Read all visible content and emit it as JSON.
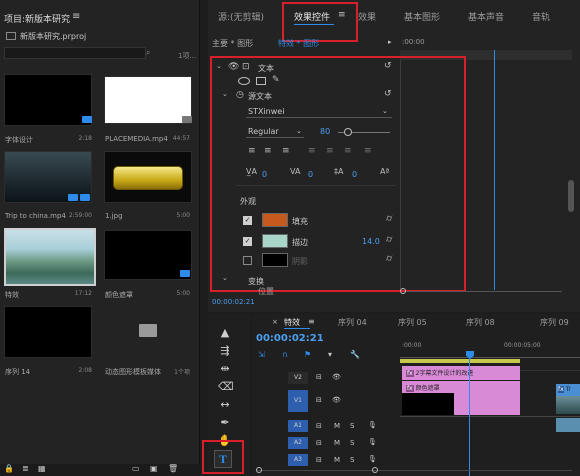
{
  "project": {
    "title": "项目:新版本研究",
    "menu_icon": "hamburger-icon",
    "file": "新版本研究.prproj",
    "count": "1项...",
    "items": [
      {
        "label": "字体设计",
        "dur": "2:18"
      },
      {
        "label": "PLACEMEDIA.mp4",
        "dur": "44:57"
      },
      {
        "label": "Trip to china.mp4",
        "dur": "2:59:00"
      },
      {
        "label": "1.jpg",
        "dur": "5:00"
      },
      {
        "label": "特效",
        "dur": "17:12"
      },
      {
        "label": "颜色遮罩",
        "dur": "5:00"
      },
      {
        "label": "序列 14",
        "dur": "2:08"
      },
      {
        "label": "动态图形模板媒体",
        "dur": "1个项"
      }
    ]
  },
  "effects": {
    "tabs": [
      "源:(无剪辑)",
      "效果控件",
      "效果",
      "基本图形",
      "基本声音",
      "音轨"
    ],
    "subhdr": "主要 * 图形",
    "subhdr2": "特效 * 图形",
    "ruler_time": ":00:00",
    "text_section": "文本",
    "source_text": "源文本",
    "font": "STXinwei",
    "style": "Regular",
    "size": "80",
    "tracking": "0",
    "kerning": "0",
    "leading": "0",
    "baseline": "0",
    "appearance": "外观",
    "fill_label": "填充",
    "stroke_label": "描边",
    "stroke_value": "14.0",
    "shadow_label": "阴影",
    "transform": "变换",
    "position_label": "位置",
    "time": "00:00:02:21",
    "fill_color": "#c45a1e",
    "stroke_color": "#a7d6c8",
    "accent": "#2d8ceb",
    "highlight": "#d9202a"
  },
  "timeline": {
    "tabs": [
      "特效",
      "序列 04",
      "序列 05",
      "序列 08",
      "序列 09"
    ],
    "time": "00:00:02:21",
    "ruler": [
      ":00:00",
      "00:00:05:00"
    ],
    "tracks": [
      "V2",
      "V1",
      "A1",
      "A2",
      "A3"
    ],
    "m": "M",
    "s": "S",
    "clip1": "2字幕文件设计的改进",
    "clip2": "颜色遮罩",
    "clip3": "Tr"
  }
}
